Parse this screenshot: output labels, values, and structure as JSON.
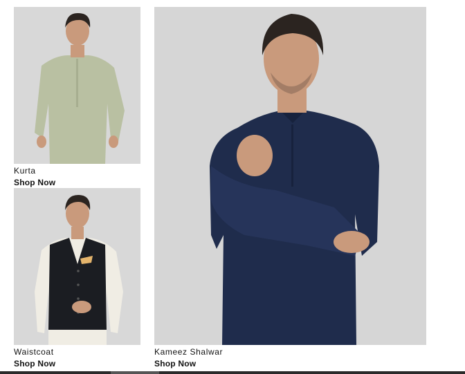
{
  "products": {
    "kurta": {
      "name": "Kurta",
      "cta": "Shop Now"
    },
    "waistcoat": {
      "name": "Waistcoat",
      "cta": "Shop Now"
    },
    "kameez_shalwar": {
      "name": "Kameez Shalwar",
      "cta": "Shop Now"
    }
  },
  "colors": {
    "backdrop": "#d6d6d6",
    "kurta_fabric": "#b9c0a2",
    "waistcoat_fabric": "#1b1d22",
    "kameez_fabric": "#1f2c4c",
    "skin": "#c99a7c",
    "hair": "#2b2420"
  }
}
